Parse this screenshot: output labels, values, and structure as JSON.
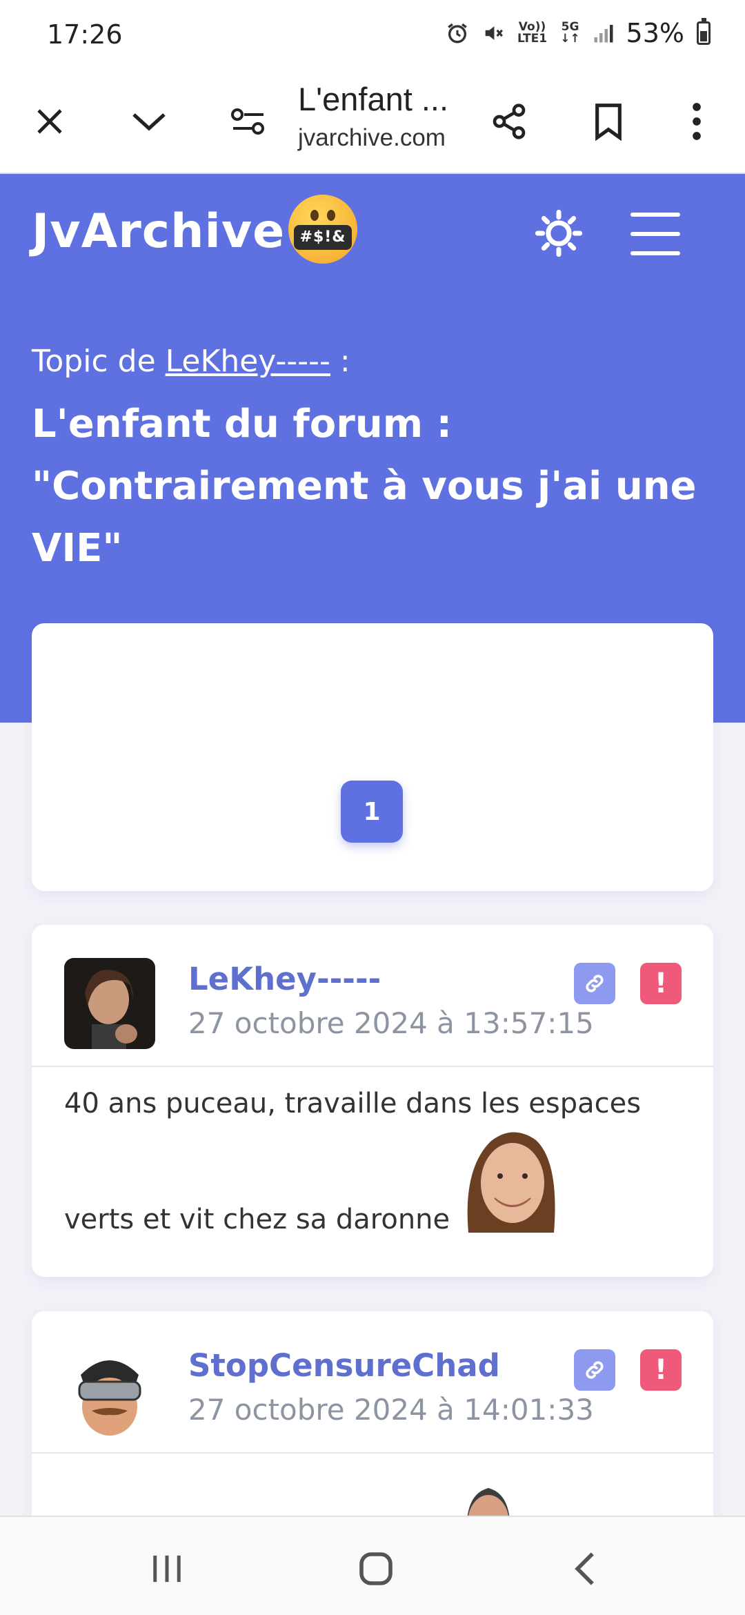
{
  "status_bar": {
    "time": "17:26",
    "volte": "Vo))\nLTE1",
    "network": "5G",
    "battery_percent": "53%",
    "battery_level": 0.53
  },
  "browser": {
    "tab_title": "L'enfant ...",
    "url": "jvarchive.com"
  },
  "site": {
    "logo": "JvArchive",
    "emoji_text": "#$!&",
    "topic_prefix": "Topic de",
    "topic_author": "LeKhey-----",
    "topic_suffix": " :",
    "topic_title": "L'enfant du forum : \"Contrairement à vous j'ai une VIE\""
  },
  "pagination": {
    "current_page": "1"
  },
  "posts": [
    {
      "author": "LeKhey-----",
      "date": "27 octobre 2024 à 13:57:15",
      "body_line1": "40 ans puceau, travaille dans les espaces",
      "body_line2": "verts et vit chez sa daronne",
      "report_label": "!"
    },
    {
      "author": "StopCensureChad",
      "date": "27 octobre 2024 à 14:01:33",
      "report_label": "!"
    }
  ],
  "colors": {
    "brand": "#5f71e0",
    "author": "#5f6fd0",
    "link_button": "#8e9af0",
    "report_button": "#f05a7a"
  }
}
